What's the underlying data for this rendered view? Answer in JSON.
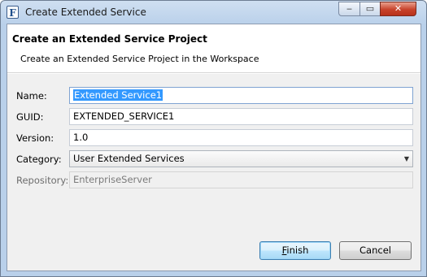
{
  "window": {
    "title": "Create Extended Service",
    "icon_letter": "F",
    "minimize_symbol": "‒",
    "maximize_symbol": "▭",
    "close_symbol": "✕"
  },
  "banner": {
    "title": "Create an Extended Service Project",
    "description": "Create an Extended Service Project in the Workspace"
  },
  "form": {
    "name": {
      "label": "Name:",
      "value": "Extended Service1"
    },
    "guid": {
      "label": "GUID:",
      "value": "EXTENDED_SERVICE1"
    },
    "version": {
      "label": "Version:",
      "value": "1.0"
    },
    "category": {
      "label": "Category:",
      "value": "User Extended Services"
    },
    "repository": {
      "label": "Repository:",
      "value": "EnterpriseServer"
    }
  },
  "buttons": {
    "finish_mnemonic": "F",
    "finish_rest": "inish",
    "cancel_label": "Cancel"
  }
}
